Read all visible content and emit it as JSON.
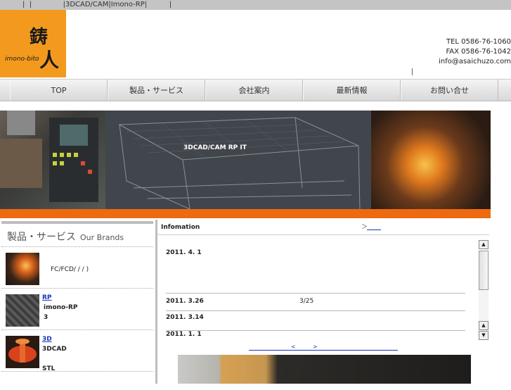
{
  "topbar": {
    "text": "|  |              |3DCAD/CAM|Imono-RP|          |"
  },
  "logo": {
    "kanji_top": "鋳",
    "kanji_bottom": "人",
    "romaji": "imono-bito"
  },
  "contact": {
    "tel": "TEL 0586-76-1060",
    "fax": "FAX 0586-76-1042",
    "email": "info@asaichuzo.com"
  },
  "nav": {
    "items": [
      "TOP",
      "製品・サービス",
      "会社案内",
      "最新情報",
      "お問い合せ"
    ]
  },
  "banner": {
    "text": "3DCAD/CAM  RP    IT"
  },
  "products": {
    "title": "製品・サービス",
    "title_en": "Our Brands",
    "items": [
      {
        "link": "",
        "line1": "FC/FCD/    /    /      )",
        "line2": ""
      },
      {
        "link": "RP",
        "line1": "imono-RP",
        "line2": "3"
      },
      {
        "link": "3D",
        "line1": "3DCAD",
        "line2": "STL"
      }
    ]
  },
  "info": {
    "label": "Infomation",
    "arrow": "＞",
    "news": [
      {
        "date": "2011. 4. 1",
        "text": ""
      },
      {
        "date": "2011. 3.26",
        "text": "3/25"
      },
      {
        "date": "2011. 3.14",
        "text": ""
      },
      {
        "date": "2011. 1. 1",
        "text": ""
      }
    ],
    "pager_prev": "<",
    "pager_next": ">"
  },
  "scroll": {
    "up": "▲",
    "down1": "▲",
    "down2": "▼"
  }
}
